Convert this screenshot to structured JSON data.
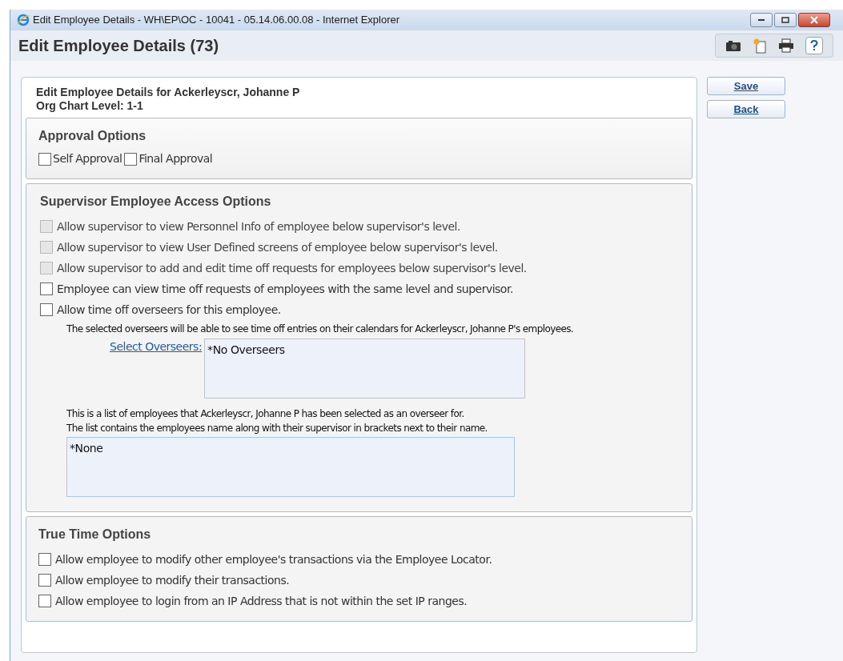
{
  "window": {
    "title": "Edit Employee Details - WH\\EP\\OC - 10041 - 05.14.06.00.08 - Internet Explorer"
  },
  "page_title": "Edit Employee Details (73)",
  "heading": {
    "line_1": "Edit Employee Details for Ackerleyscr, Johanne P",
    "line_2": "Org Chart Level: 1-1"
  },
  "buttons": [
    "Save",
    "Back"
  ],
  "approval_options": {
    "title": "Approval Options",
    "options": [
      {
        "label": "Self Approval",
        "checked": false
      },
      {
        "label": "Final Approval",
        "checked": false
      }
    ]
  },
  "supervisor_access": {
    "title": "Supervisor Employee Access Options",
    "options": [
      {
        "label": "Allow supervisor to view Personnel Info of employee below supervisor's level.",
        "checked": false,
        "disabled": true
      },
      {
        "label": "Allow supervisor to view User Defined screens of employee below supervisor's level.",
        "checked": false,
        "disabled": true
      },
      {
        "label": "Allow supervisor to add and edit time off requests for employees below supervisor's level.",
        "checked": false,
        "disabled": true
      },
      {
        "label": "Employee can view time off requests of employees with the same level and supervisor.",
        "checked": false,
        "disabled": false
      },
      {
        "label": "Allow time off overseers for this employee.",
        "checked": false,
        "disabled": false
      }
    ],
    "overseer_note": "The selected overseers will be able to see time off entries on their calendars for Ackerleyscr, Johanne P's employees.",
    "select_overseers_link": "Select Overseers:",
    "overseers_list": [
      "*No Overseers"
    ],
    "overseen_note_1": "This is a list of employees that Ackerleyscr, Johanne P has been selected as an overseer for.",
    "overseen_note_2": "The list contains the employees name along with their supervisor in brackets next to their name.",
    "overseen_list": [
      "*None"
    ]
  },
  "true_time_options": {
    "title": "True Time Options",
    "options": [
      {
        "label": "Allow employee to modify other employee's transactions via the Employee Locator.",
        "checked": false
      },
      {
        "label": "Allow employee to modify their transactions.",
        "checked": false
      },
      {
        "label": "Allow employee to login from an IP Address that is not within the set IP ranges.",
        "checked": false
      }
    ]
  }
}
